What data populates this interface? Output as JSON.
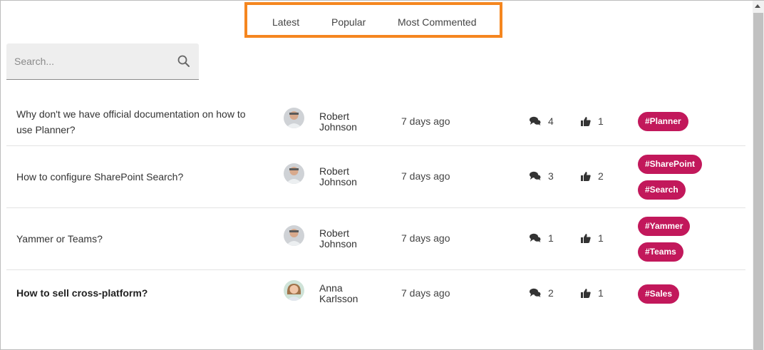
{
  "tabs": [
    {
      "label": "Latest"
    },
    {
      "label": "Popular"
    },
    {
      "label": "Most Commented"
    }
  ],
  "search": {
    "placeholder": "Search..."
  },
  "colors": {
    "highlight_border": "#f5861f",
    "tag_bg": "#c2185b"
  },
  "icons": {
    "search": "search-icon",
    "comments": "comments-icon",
    "likes": "thumbs-up-icon"
  },
  "posts": [
    {
      "title": "Why don't we have official documentation on how to use Planner?",
      "author_first": "Robert",
      "author_last": "Johnson",
      "date": "7 days ago",
      "comments": "4",
      "likes": "1",
      "tags": [
        "#Planner"
      ]
    },
    {
      "title": "How to configure SharePoint Search?",
      "author_first": "Robert",
      "author_last": "Johnson",
      "date": "7 days ago",
      "comments": "3",
      "likes": "2",
      "tags": [
        "#SharePoint",
        "#Search"
      ]
    },
    {
      "title": "Yammer or Teams?",
      "author_first": "Robert",
      "author_last": "Johnson",
      "date": "7 days ago",
      "comments": "1",
      "likes": "1",
      "tags": [
        "#Yammer",
        "#Teams"
      ]
    },
    {
      "title": "How to sell cross-platform?",
      "author_first": "Anna",
      "author_last": "Karlsson",
      "date": "7 days ago",
      "comments": "2",
      "likes": "1",
      "tags": [
        "#Sales"
      ]
    }
  ]
}
